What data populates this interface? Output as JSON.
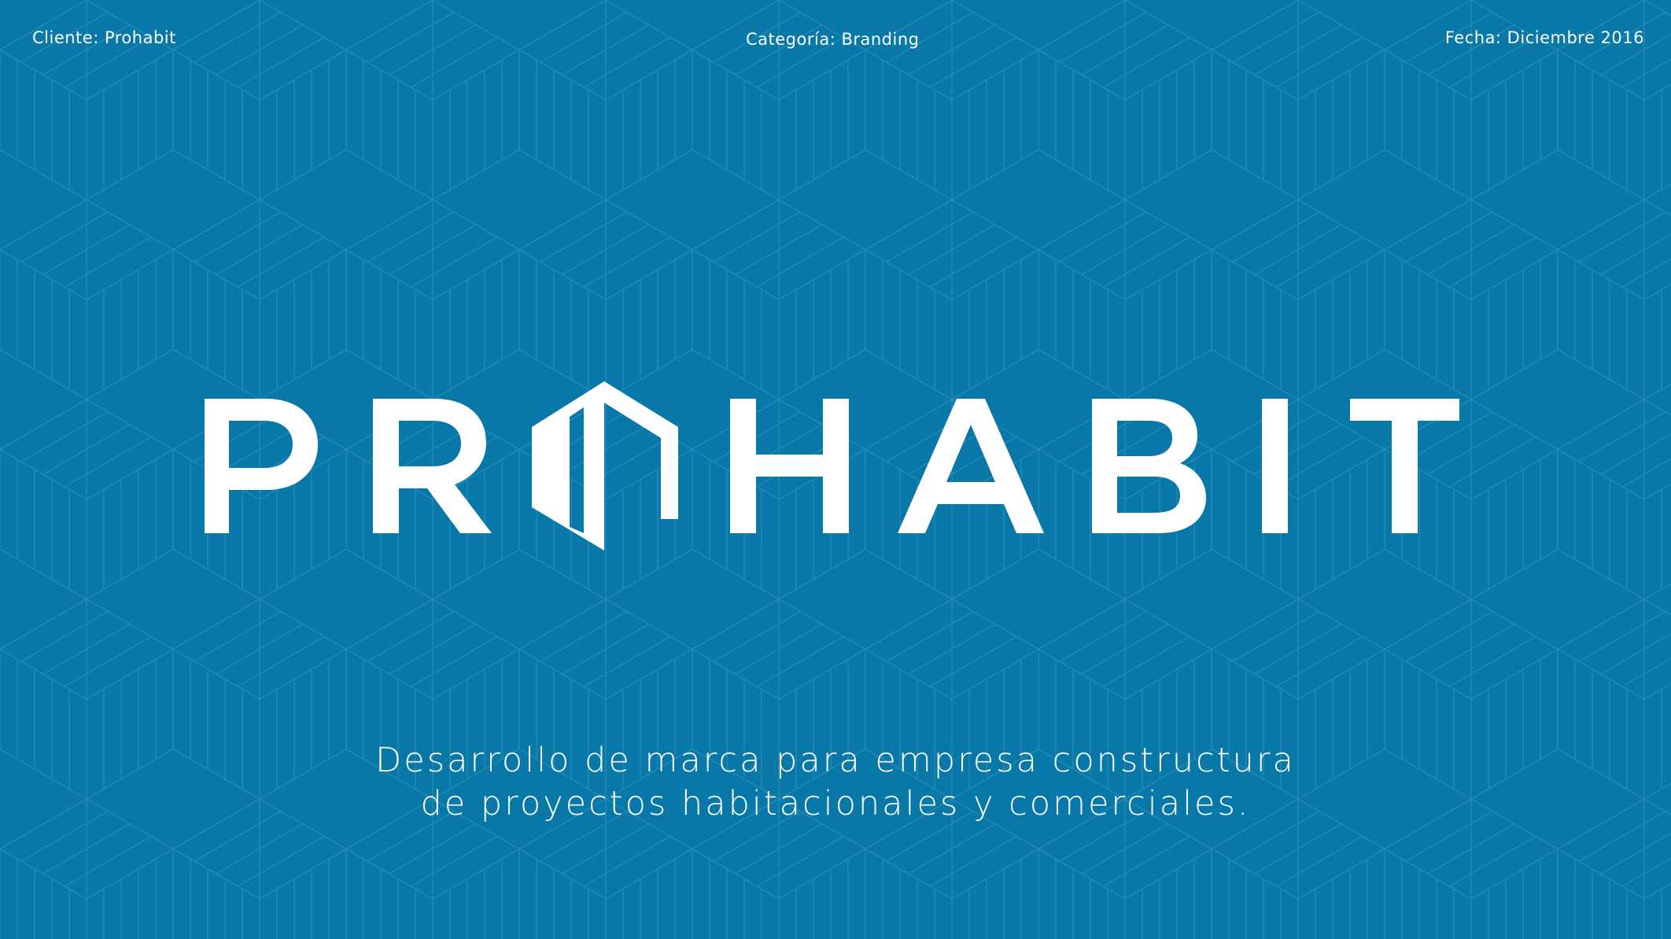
{
  "meta": {
    "client": "Cliente: Prohabit",
    "category": "Categoría: Branding",
    "date": "Fecha: Diciembre 2016"
  },
  "logo": {
    "wordmark": "PROHABIT",
    "house_icon": "house-cube-icon"
  },
  "tagline": {
    "line1": "Desarrollo de marca para empresa constructura",
    "line2": "de proyectos habitacionales y comerciales."
  },
  "colors": {
    "background": "#0878a8",
    "pattern_line": "#2a8cb8",
    "foreground": "#ffffff"
  }
}
